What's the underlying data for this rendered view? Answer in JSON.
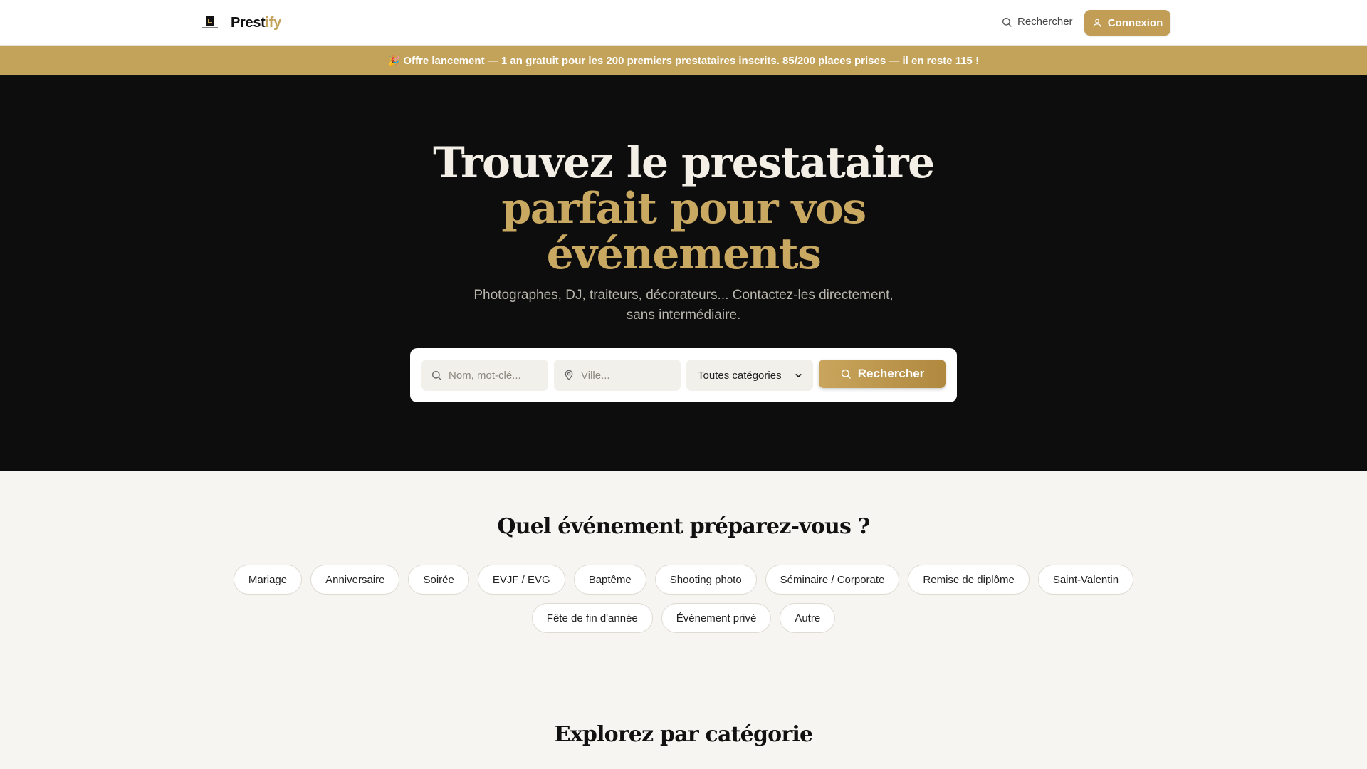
{
  "header": {
    "brand_part1": "Prest",
    "brand_part2": "ify",
    "search_label": "Rechercher",
    "login_label": "Connexion"
  },
  "banner": {
    "emoji": "🎉",
    "text": "Offre lancement — 1 an gratuit pour les 200 premiers prestataires inscrits. 85/200 places prises — il en reste 115 !"
  },
  "hero": {
    "title_line1": "Trouvez le prestataire",
    "title_line2": "parfait pour vos",
    "title_line3": "événements",
    "subtitle": "Photographes, DJ, traiteurs, décorateurs... Contactez-les directement, sans intermédiaire.",
    "search": {
      "keyword_placeholder": "Nom, mot-clé...",
      "city_placeholder": "Ville...",
      "category_selected": "Toutes catégories",
      "button_label": "Rechercher"
    }
  },
  "events": {
    "title": "Quel événement préparez-vous ?",
    "chips": [
      "Mariage",
      "Anniversaire",
      "Soirée",
      "EVJF / EVG",
      "Baptême",
      "Shooting photo",
      "Séminaire / Corporate",
      "Remise de diplôme",
      "Saint-Valentin",
      "Fête de fin d'année",
      "Événement privé",
      "Autre"
    ]
  },
  "categories": {
    "title": "Explorez par catégorie"
  },
  "colors": {
    "accent": "#c3a25a",
    "hero_bg": "#0d0d0d",
    "page_bg": "#f6f5f1"
  }
}
